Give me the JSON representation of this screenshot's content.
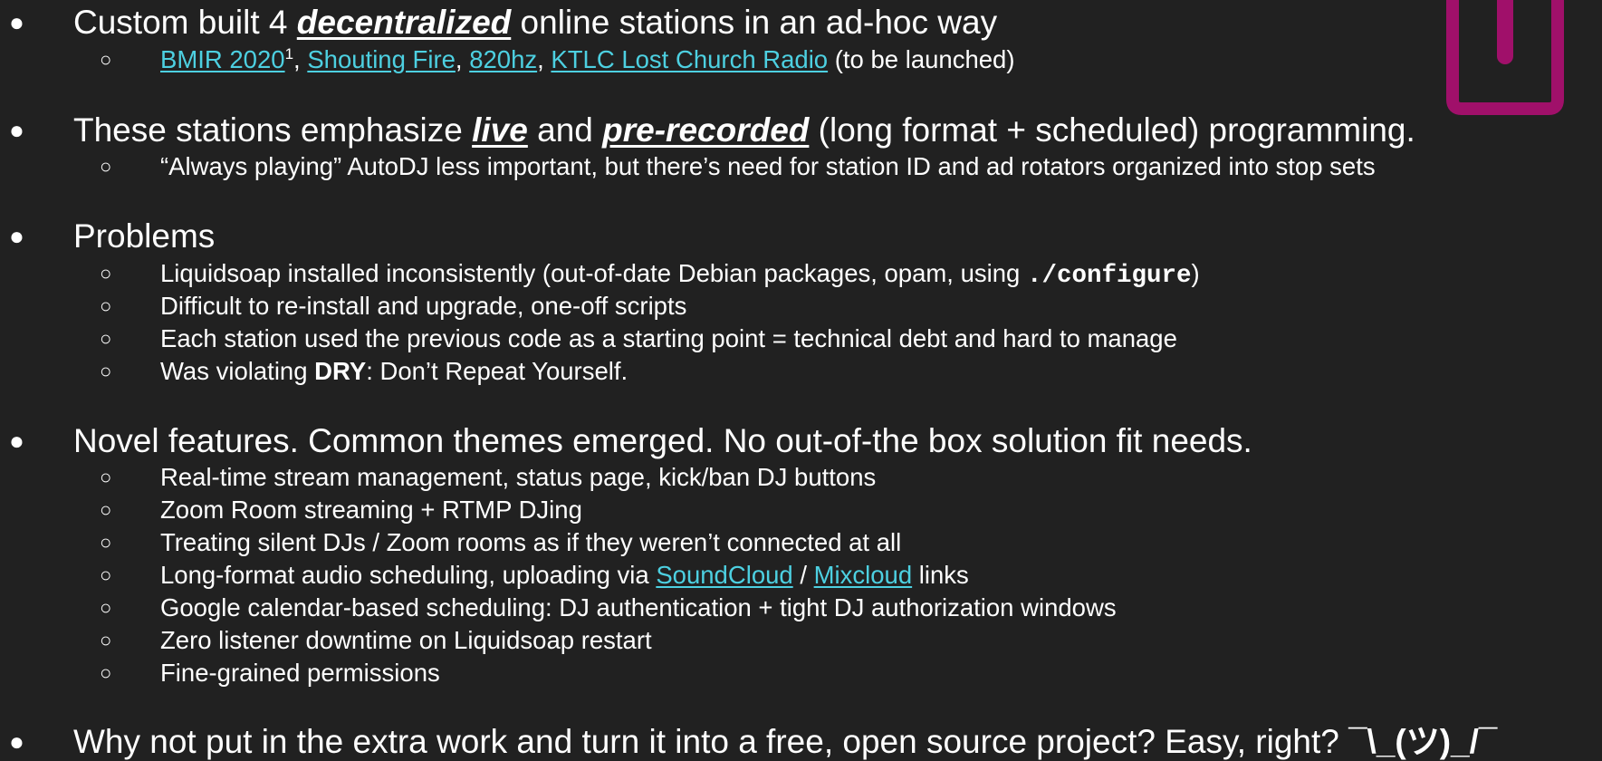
{
  "colors": {
    "background": "#212121",
    "text": "#ffffff",
    "link": "#4dd0e1",
    "accent": "#a0106a"
  },
  "decoration": {
    "icon": "magenta-bracket-shape"
  },
  "bullets": {
    "l1": "●",
    "l2": "○"
  },
  "b1": {
    "pre": "Custom built 4 ",
    "emph": "decentralized",
    "post": " online stations in an ad-hoc way",
    "sub": {
      "link1": "BMIR 2020",
      "sup": "1",
      "sep1": ", ",
      "link2": "Shouting Fire",
      "sep2": ", ",
      "link3": "820hz",
      "sep3": ", ",
      "link4": "KTLC Lost Church Radio",
      "post": " (to be launched)"
    }
  },
  "b2": {
    "pre": "These stations emphasize ",
    "emph1": "live",
    "mid": " and ",
    "emph2": "pre-recorded",
    "post": " (long format + scheduled) programming.",
    "sub": {
      "text": "“Always playing” AutoDJ less important, but there’s need for station ID and ad rotators organized into stop sets"
    }
  },
  "b3": {
    "text": "Problems",
    "sub1": {
      "pre": "Liquidsoap installed inconsistently (out-of-date Debian packages, opam, using ",
      "code": "./configure",
      "post": ")"
    },
    "sub2": "Difficult to re-install and upgrade, one-off scripts",
    "sub3": "Each station used the previous code as a starting point = technical debt and hard to manage",
    "sub4": {
      "pre": "Was violating ",
      "bold": "DRY",
      "post": ": Don’t Repeat Yourself."
    }
  },
  "b4": {
    "text": "Novel features. Common themes emerged. No out-of-the box solution fit needs.",
    "sub1": "Real-time stream management, status page, kick/ban DJ buttons",
    "sub2": "Zoom Room streaming + RTMP DJing",
    "sub3": "Treating silent DJs / Zoom rooms as if they weren’t connected at all",
    "sub4": {
      "pre": "Long-format audio scheduling, uploading via ",
      "link1": "SoundCloud",
      "sep": " / ",
      "link2": "Mixcloud",
      "post": " links"
    },
    "sub5": "Google calendar-based scheduling: DJ authentication + tight DJ authorization windows",
    "sub6": "Zero listener downtime on Liquidsoap restart",
    "sub7": "Fine-grained permissions"
  },
  "b5": {
    "text": "Why not put in the extra work and turn it into a free, open source project? Easy, right? ",
    "shrug": "¯\\_(ツ)_/¯"
  }
}
